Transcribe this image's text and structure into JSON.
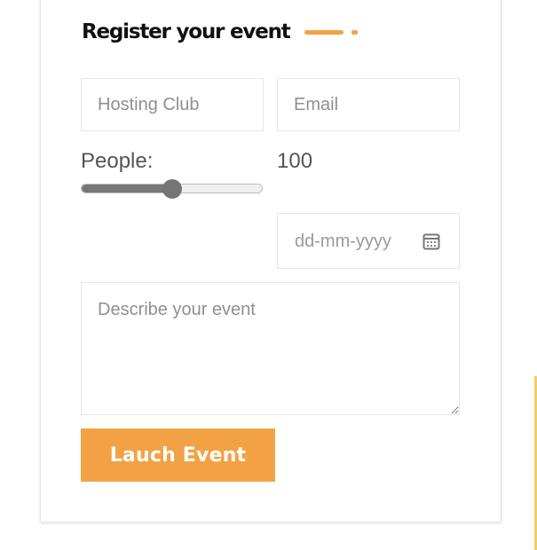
{
  "form": {
    "title": "Register your event",
    "accent_color": "#f2a245",
    "fields": {
      "hosting_club": {
        "placeholder": "Hosting Club",
        "value": ""
      },
      "email": {
        "placeholder": "Email",
        "value": ""
      },
      "people": {
        "label": "People:",
        "value": "100",
        "slider_fraction": 0.5
      },
      "date": {
        "placeholder": "dd-mm-yyyy",
        "icon": "calendar-icon"
      },
      "description": {
        "placeholder": "Describe your event",
        "value": ""
      }
    },
    "submit_label": "Lauch Event"
  }
}
